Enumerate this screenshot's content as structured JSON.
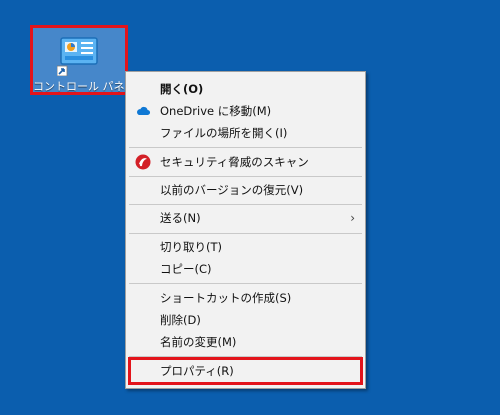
{
  "desktop_icon": {
    "label": "コントロール パネル",
    "icon": "control-panel-icon"
  },
  "menu": {
    "open": "開く(O)",
    "onedrive": "OneDrive に移動(M)",
    "open_location": "ファイルの場所を開く(I)",
    "security_scan": "セキュリティ脅威のスキャン",
    "restore_previous": "以前のバージョンの復元(V)",
    "send_to": "送る(N)",
    "cut": "切り取り(T)",
    "copy": "コピー(C)",
    "create_shortcut": "ショートカットの作成(S)",
    "delete": "削除(D)",
    "rename": "名前の変更(M)",
    "properties": "プロパティ(R)"
  },
  "colors": {
    "desktop": "#0b5eae",
    "highlight_border": "#e3141b",
    "onedrive_blue": "#0f78d4",
    "security_red": "#d32027"
  }
}
